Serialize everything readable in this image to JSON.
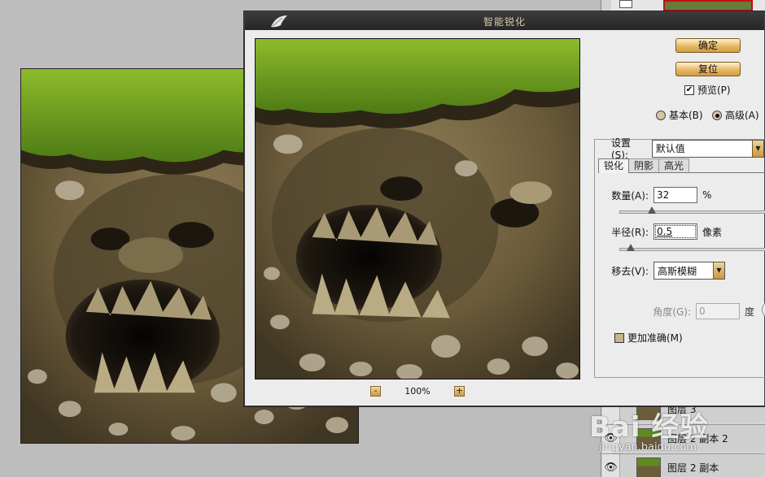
{
  "dialog": {
    "title": "智能锐化",
    "ok_label": "确定",
    "reset_label": "复位",
    "preview_label": "预览(P)",
    "preview_checked": true,
    "mode_basic_label": "基本(B)",
    "mode_advanced_label": "高级(A)",
    "mode_selected": "advanced",
    "settings_label": "设置(S):",
    "settings_value": "默认值",
    "tabs": [
      {
        "label": "锐化",
        "active": true
      },
      {
        "label": "阴影",
        "active": false
      },
      {
        "label": "高光",
        "active": false
      }
    ],
    "amount_label": "数量(A):",
    "amount_value": "32",
    "amount_unit": "%",
    "amount_fraction": 0.064,
    "radius_label": "半径(R):",
    "radius_value": "0.5",
    "radius_unit": "像素",
    "radius_fraction": 0.008,
    "remove_label": "移去(V):",
    "remove_value": "高斯模糊",
    "angle_label": "角度(G):",
    "angle_value": "0",
    "angle_unit": "度",
    "more_accurate_label": "更加准确(M)",
    "more_accurate_checked": false,
    "zoom_out_label": "-",
    "zoom_level": "100%",
    "zoom_in_label": "+"
  },
  "layers": {
    "rows": [
      {
        "name": "图层 3",
        "visible": false
      },
      {
        "name": "图层 2 副本 2",
        "visible": true
      },
      {
        "name": "图层 2 副本",
        "visible": true
      }
    ]
  },
  "watermark": {
    "main": "Bai 经验",
    "sub": "jingyan.baidu.com"
  },
  "colors": {
    "titlebar": "#2e2e2e",
    "title_text": "#d7c9a6",
    "button_gold": "#e7b865",
    "dialog_bg": "#ececec",
    "workspace_bg": "#bdbdbd"
  }
}
